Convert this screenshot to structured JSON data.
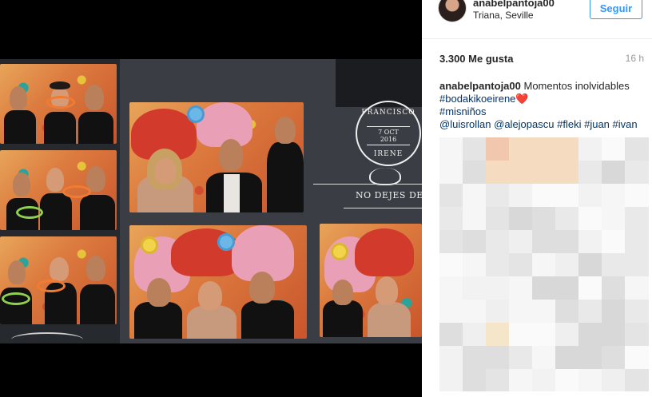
{
  "post": {
    "username": "anabelpantoja00",
    "location": "Triana, Seville",
    "follow_label": "Seguir",
    "likes": "3.300 Me gusta",
    "time_ago": "16 h",
    "caption": {
      "username": "anabelpantoja00",
      "text": "Momentos inolvidables",
      "tag1": "#bodakikoeirene",
      "heart": "❤️",
      "tag2": "#misniños",
      "mention1": "@luisrollan",
      "mention2": "@alejopascu",
      "tag3": "#fleki",
      "tag4": "#juan",
      "tag5": "#ivan"
    }
  },
  "photo": {
    "stamp_name1": "FRANCISCO",
    "stamp_date": "7 OCT",
    "stamp_year": "2016",
    "stamp_name2": "IRENE",
    "slogan": "NO DEJES DE"
  },
  "colors": {
    "link": "#003569",
    "follow": "#3897f0",
    "muted": "#999999"
  }
}
